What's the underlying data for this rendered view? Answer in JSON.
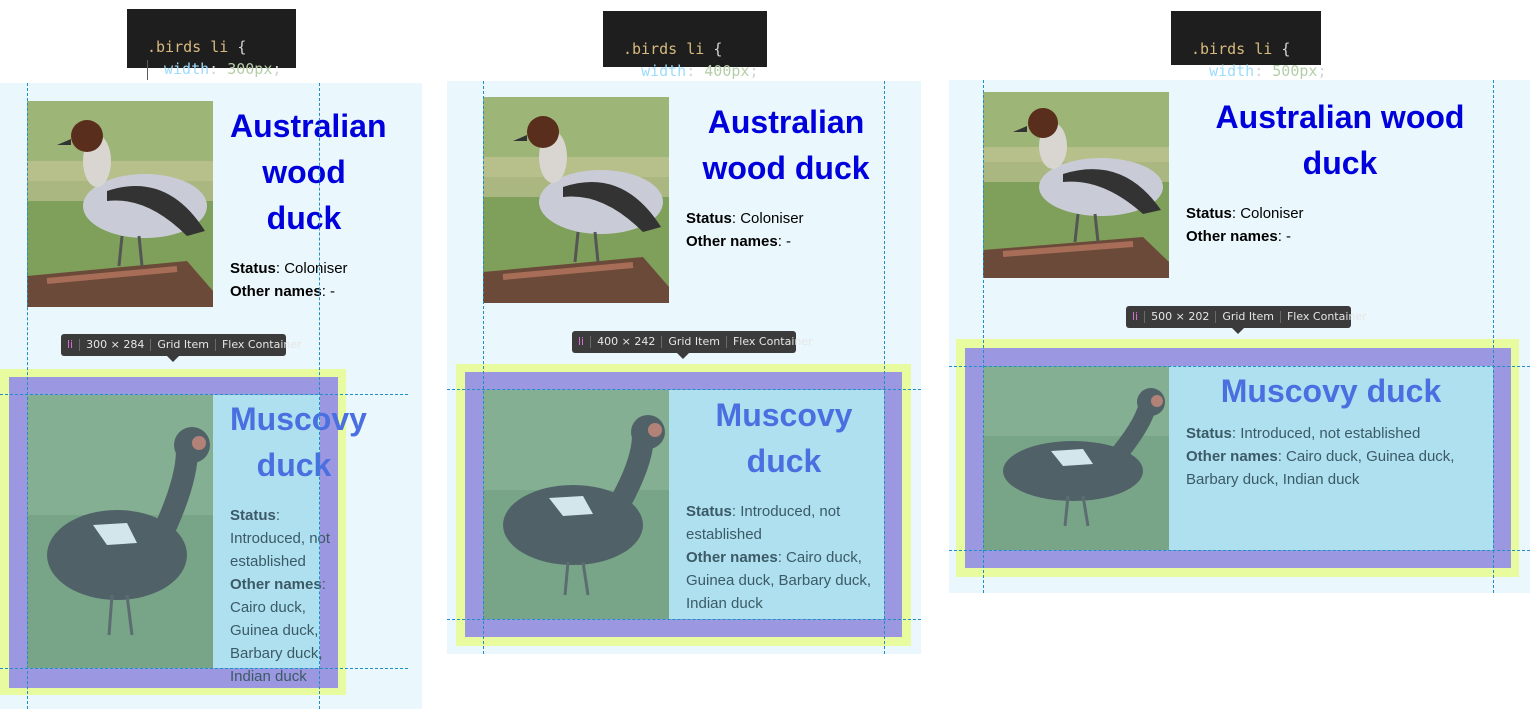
{
  "panels": [
    {
      "code": {
        "selector": ".birds li",
        "brace_open": "{",
        "property": "width",
        "value": "300px",
        "end": ";"
      },
      "tooltip": {
        "tag": "li",
        "size": "300 × 284",
        "item": "Grid Item",
        "container": "Flex Container"
      },
      "birds": [
        {
          "name": "Australian wood duck",
          "status_label": "Status",
          "status": "Coloniser",
          "other_label": "Other names",
          "other": "-"
        },
        {
          "name": "Muscovy duck",
          "status_label": "Status",
          "status": "Introduced, not established",
          "other_label": "Other names",
          "other": "Cairo duck, Guinea duck, Barbary duck, Indian duck"
        }
      ]
    },
    {
      "code": {
        "selector": ".birds li",
        "brace_open": "{",
        "property": "width",
        "value": "400px",
        "end": ";"
      },
      "tooltip": {
        "tag": "li",
        "size": "400 × 242",
        "item": "Grid Item",
        "container": "Flex Container"
      },
      "birds": [
        {
          "name": "Australian wood duck",
          "status_label": "Status",
          "status": "Coloniser",
          "other_label": "Other names",
          "other": "-"
        },
        {
          "name": "Muscovy duck",
          "status_label": "Status",
          "status": "Introduced, not established",
          "other_label": "Other names",
          "other": "Cairo duck, Guinea duck, Barbary duck, Indian duck"
        }
      ]
    },
    {
      "code": {
        "selector": ".birds li",
        "brace_open": "{",
        "property": "width",
        "value": "500px",
        "end": ";"
      },
      "tooltip": {
        "tag": "li",
        "size": "500 × 202",
        "item": "Grid Item",
        "container": "Flex Container"
      },
      "birds": [
        {
          "name": "Australian wood duck",
          "status_label": "Status",
          "status": "Coloniser",
          "other_label": "Other names",
          "other": "-"
        },
        {
          "name": "Muscovy duck",
          "status_label": "Status",
          "status": "Introduced, not established",
          "other_label": "Other names",
          "other": "Cairo duck, Guinea duck, Barbary duck, Indian duck"
        }
      ]
    }
  ],
  "colors": {
    "heading": "#0000dd",
    "pane_bg": "#eaf7fc",
    "margin_highlight": "#e9fb9f",
    "border_highlight": "#9b97e1",
    "content_highlight": "#aee0ef",
    "guide_line": "#1e90c8"
  },
  "icons": {
    "wood_duck": "wood-duck-photo",
    "muscovy_duck": "muscovy-duck-photo"
  }
}
